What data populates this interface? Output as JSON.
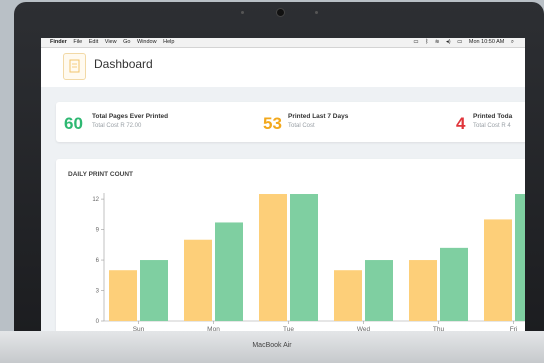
{
  "device": {
    "brand": "MacBook Air"
  },
  "menubar": {
    "apple": "",
    "items": [
      "Finder",
      "File",
      "Edit",
      "View",
      "Go",
      "Window",
      "Help"
    ],
    "clock": "Mon 10:50 AM"
  },
  "header": {
    "title": "Dashboard"
  },
  "stats": [
    {
      "number": "60",
      "title": "Total Pages Ever Printed",
      "subtitle": "Total Cost R 72.00",
      "color": "#2eb872"
    },
    {
      "number": "53",
      "title": "Printed Last 7 Days",
      "subtitle": "Total Cost",
      "color": "#f2a81d"
    },
    {
      "number": "4",
      "title": "Printed Toda",
      "subtitle": "Total Cost R 4",
      "color": "#e0353b"
    }
  ],
  "chart_data": {
    "type": "bar",
    "title": "DAILY PRINT COUNT",
    "categories": [
      "Sun",
      "Mon",
      "Tue",
      "Wed",
      "Thu",
      "Fri"
    ],
    "series": [
      {
        "values": [
          5,
          8,
          12.5,
          5,
          6,
          10
        ],
        "color": "#fdcf79"
      },
      {
        "values": [
          6,
          9.7,
          12.5,
          6,
          7.2,
          12.5
        ],
        "color": "#7fcfa1"
      }
    ],
    "yticks": [
      0,
      3,
      6,
      9,
      12
    ],
    "ylim": [
      0,
      12.6
    ]
  }
}
